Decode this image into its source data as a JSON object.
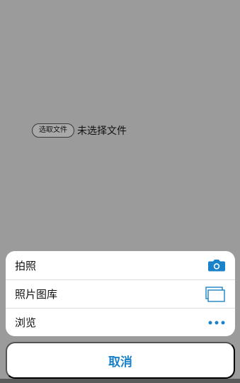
{
  "file_input": {
    "button_label": "选取文件",
    "status_text": "未选择文件"
  },
  "action_sheet": {
    "items": [
      {
        "label": "拍照",
        "icon": "camera-icon"
      },
      {
        "label": "照片图库",
        "icon": "photo-library-icon"
      },
      {
        "label": "浏览",
        "icon": "more-dots-icon"
      }
    ],
    "icon_color": "#1a82c8"
  },
  "cancel": {
    "label": "取消",
    "color": "#1a82c8"
  }
}
